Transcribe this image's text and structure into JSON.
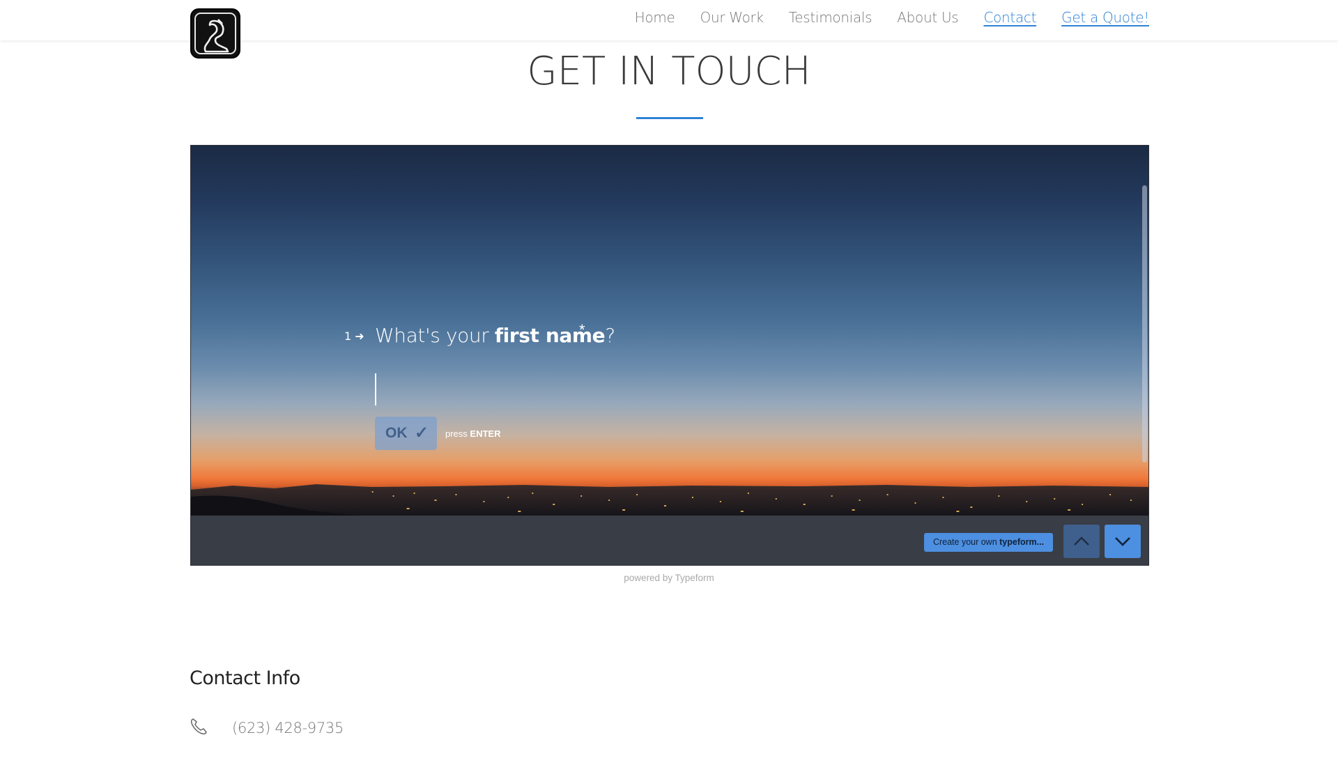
{
  "nav": {
    "items": [
      {
        "label": "Home",
        "active": false
      },
      {
        "label": "Our Work",
        "active": false
      },
      {
        "label": "Testimonials",
        "active": false
      },
      {
        "label": "About Us",
        "active": false
      },
      {
        "label": "Contact",
        "active": true
      },
      {
        "label": "Get a Quote!",
        "active": true
      }
    ]
  },
  "page": {
    "heading": "GET IN TOUCH",
    "accent_color": "#2e82d6"
  },
  "typeform": {
    "question_number": "1",
    "question_prefix": "What's your ",
    "question_bold": "first name",
    "question_suffix": "?",
    "required_mark": "*",
    "ok_label": "OK",
    "check_icon": "check-icon",
    "press_prefix": "press ",
    "press_key": "ENTER",
    "create_prefix": "Create your own ",
    "create_bold": "typeform",
    "create_suffix": "...",
    "prev_icon": "chevron-up-icon",
    "next_icon": "chevron-down-icon",
    "powered_by": "powered by Typeform"
  },
  "contact": {
    "title": "Contact Info",
    "phone_icon": "phone-icon",
    "phone": "(623) 428-9735"
  }
}
